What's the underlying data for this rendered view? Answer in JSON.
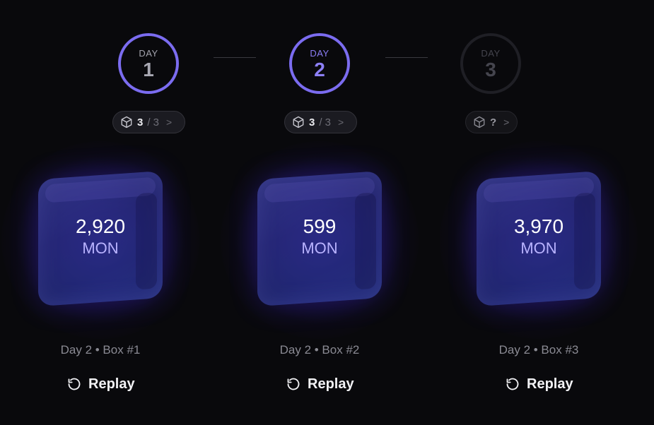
{
  "days": [
    {
      "label": "DAY",
      "number": "1"
    },
    {
      "label": "DAY",
      "number": "2"
    },
    {
      "label": "DAY",
      "number": "3"
    }
  ],
  "pills": [
    {
      "count": "3",
      "total": "/ 3",
      "arrow": ">"
    },
    {
      "count": "3",
      "total": "/ 3",
      "arrow": ">"
    },
    {
      "count": "?",
      "arrow": ">"
    }
  ],
  "rewards": [
    {
      "amount": "2,920",
      "currency": "MON",
      "caption": "Day 2 • Box #1"
    },
    {
      "amount": "599",
      "currency": "MON",
      "caption": "Day 2 • Box #2"
    },
    {
      "amount": "3,970",
      "currency": "MON",
      "caption": "Day 2 • Box #3"
    }
  ],
  "replay_label": "Replay",
  "icons": {
    "box": "box-icon",
    "replay": "replay-icon",
    "chevron": "chevron-right-icon"
  },
  "colors": {
    "accent": "#7b6cf0",
    "background": "#09090c",
    "inactive": "#1f1f25"
  }
}
